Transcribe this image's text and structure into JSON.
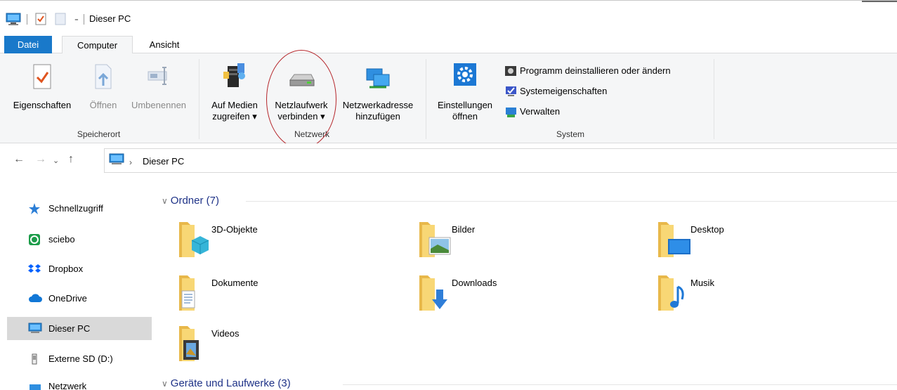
{
  "window": {
    "title": "Dieser PC"
  },
  "ribbon_tabs": {
    "datei": "Datei",
    "computer": "Computer",
    "ansicht": "Ansicht"
  },
  "ribbon": {
    "speicherort": {
      "label": "Speicherort",
      "eigenschaften": "Eigenschaften",
      "oeffnen": "Öffnen",
      "umbenennen": "Umbenennen"
    },
    "netzwerk": {
      "label": "Netzwerk",
      "medien_line1": "Auf Medien",
      "medien_line2": "zugreifen ▾",
      "netzlaufwerk_line1": "Netzlaufwerk",
      "netzlaufwerk_line2": "verbinden ▾",
      "adresse_line1": "Netzwerkadresse",
      "adresse_line2": "hinzufügen"
    },
    "system": {
      "label": "System",
      "einstellungen_line1": "Einstellungen",
      "einstellungen_line2": "öffnen",
      "programm": "Programm deinstallieren oder ändern",
      "systemeigenschaften": "Systemeigenschaften",
      "verwalten": "Verwalten"
    }
  },
  "address": {
    "path": "Dieser PC"
  },
  "sidebar": {
    "items": [
      {
        "label": "Schnellzugriff"
      },
      {
        "label": "sciebo"
      },
      {
        "label": "Dropbox"
      },
      {
        "label": "OneDrive"
      },
      {
        "label": "Dieser PC"
      },
      {
        "label": "Externe SD (D:)"
      },
      {
        "label": "Netzwerk"
      }
    ]
  },
  "main": {
    "sections": {
      "ordner": "Ordner (7)",
      "geraete": "Geräte und Laufwerke (3)"
    },
    "folders": [
      {
        "name": "3D-Objekte"
      },
      {
        "name": "Bilder"
      },
      {
        "name": "Desktop"
      },
      {
        "name": "Dokumente"
      },
      {
        "name": "Downloads"
      },
      {
        "name": "Musik"
      },
      {
        "name": "Videos"
      }
    ]
  },
  "colors": {
    "accent": "#1979ca",
    "ribbon_bg": "#f5f6f7",
    "section_text": "#1e3287",
    "folder_yellow": "#f8d775",
    "annotation_red": "#b5262b"
  }
}
